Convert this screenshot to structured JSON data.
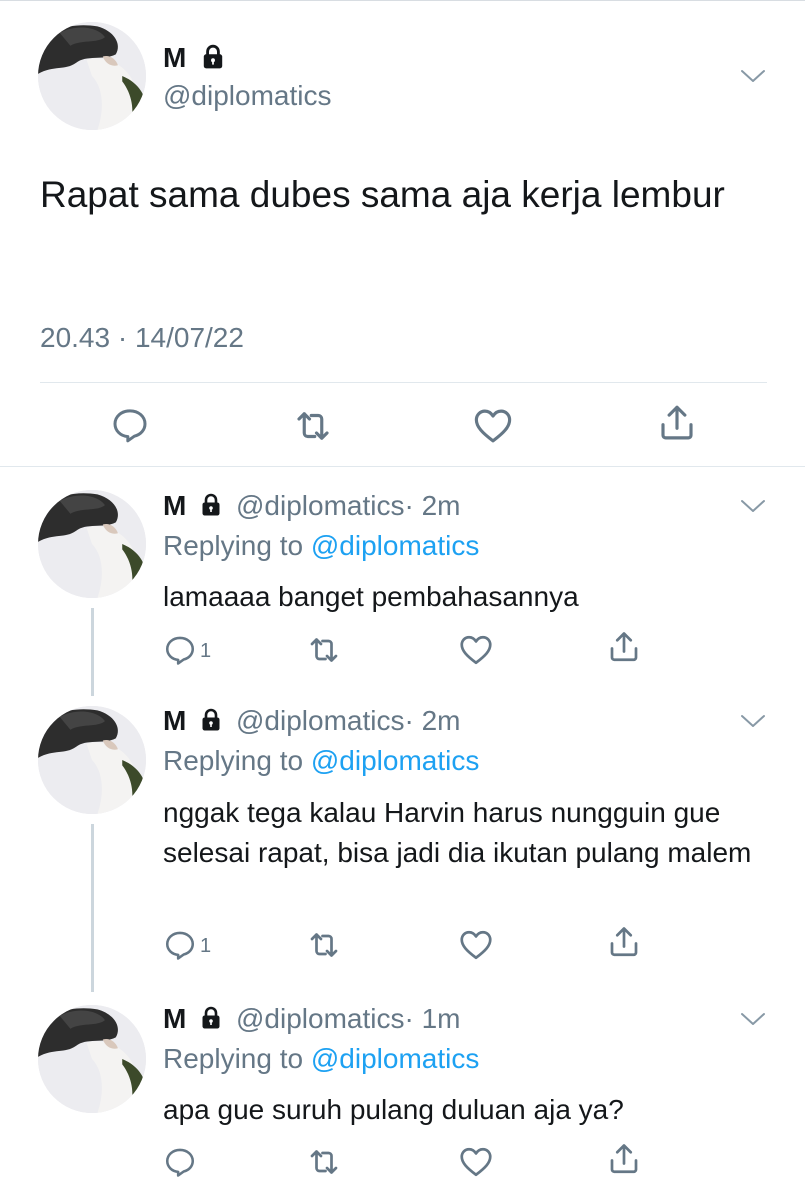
{
  "main_tweet": {
    "name": "M",
    "handle": "@diplomatics",
    "text": "Rapat sama dubes sama aja kerja lembur",
    "timestamp": "20.43 · 14/07/22",
    "icons": [
      "reply-icon",
      "retweet-icon",
      "like-icon",
      "share-icon",
      "lock-icon",
      "chevron-down-icon"
    ]
  },
  "replies": [
    {
      "name": "M",
      "handle": "@diplomatics",
      "time": "· 2m",
      "replying_prefix": "Replying to ",
      "replying_to": "@diplomatics",
      "text": "lamaaaa banget pembahasannya",
      "reply_count": "1"
    },
    {
      "name": "M",
      "handle": "@diplomatics",
      "time": "· 2m",
      "replying_prefix": "Replying to ",
      "replying_to": "@diplomatics",
      "text": "nggak tega kalau Harvin harus nungguin gue selesai rapat, bisa jadi dia ikutan pulang malem",
      "reply_count": "1"
    },
    {
      "name": "M",
      "handle": "@diplomatics",
      "time": "· 1m",
      "replying_prefix": "Replying to ",
      "replying_to": "@diplomatics",
      "text": "apa gue suruh pulang duluan aja ya?",
      "reply_count": ""
    }
  ],
  "colors": {
    "text": "#14171a",
    "secondary": "#657786",
    "link": "#1da1f2",
    "divider": "#e1e8ed"
  }
}
